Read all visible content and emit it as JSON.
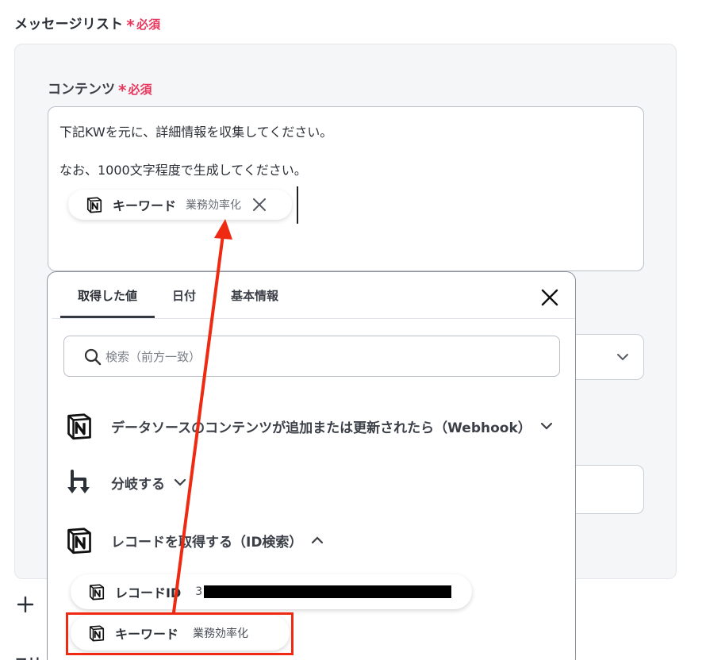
{
  "form": {
    "message_list_label": "メッセージリスト",
    "required_text": "必須",
    "content_label": "コンテンツ",
    "bottom_partial_label": "コリー"
  },
  "editor": {
    "line1": "下記KWを元に、詳細情報を収集してください。",
    "line2": "なお、1000文字程度で生成してください。",
    "chip": {
      "icon": "notion-icon",
      "name": "キーワード",
      "value": "業務効率化"
    }
  },
  "dropdown": {
    "tabs": [
      "取得した値",
      "日付",
      "基本情報"
    ],
    "active_tab": "取得した値",
    "search_placeholder": "検索（前方一致）",
    "groups": [
      {
        "icon": "notion-icon",
        "title": "データソースのコンテンツが追加または更新されたら（Webhook）",
        "state": "collapsed"
      },
      {
        "icon": "branch-icon",
        "title": "分岐する",
        "state": "collapsed"
      },
      {
        "icon": "notion-icon",
        "title": "レコードを取得する（ID検索）",
        "state": "expanded"
      }
    ],
    "items": [
      {
        "icon": "notion-icon",
        "name": "レコードID",
        "value": "3",
        "value_redacted": true
      },
      {
        "icon": "notion-icon",
        "name": "キーワード",
        "value": "業務効率化"
      }
    ]
  },
  "annotation": {
    "color": "#ee2a12"
  },
  "colors": {
    "required": "#e8365d",
    "panel_bg": "#f5f6f8",
    "text": "#2b2f36"
  }
}
